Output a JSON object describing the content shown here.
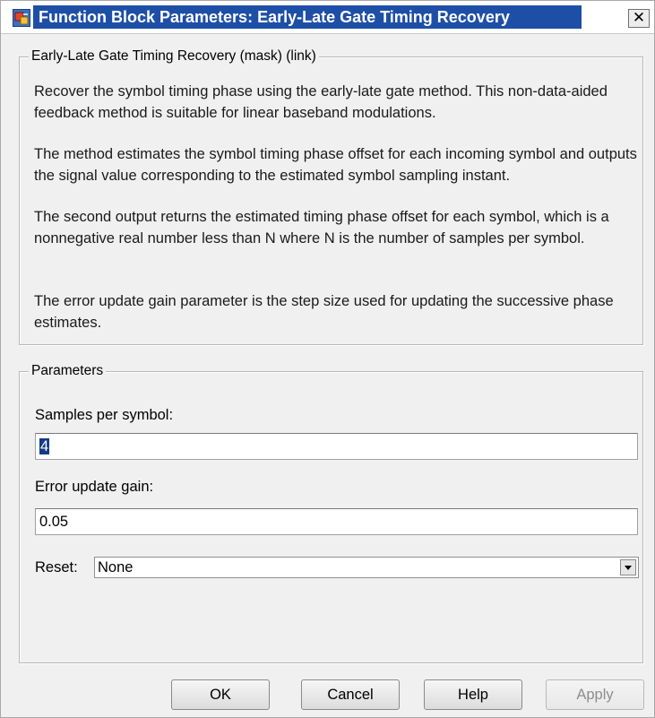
{
  "window": {
    "title": "Function Block Parameters: Early-Late Gate Timing Recovery",
    "close_glyph": "✕",
    "icon": "simulink-block-icon",
    "title_bar_color": "#1e4fa6"
  },
  "description": {
    "legend": "Early-Late Gate Timing Recovery (mask) (link)",
    "paragraphs": [
      "Recover the symbol timing phase using the early-late gate method. This non-data-aided feedback method is suitable for linear baseband modulations.",
      "The method estimates the symbol timing phase offset for each incoming symbol and outputs the signal value corresponding to the estimated symbol sampling instant.",
      "The second output returns the estimated timing phase offset for each symbol, which is a nonnegative real number less than N where N is the number of samples per symbol.",
      "The error update gain parameter is the step size used for updating the successive phase estimates."
    ]
  },
  "parameters": {
    "legend": "Parameters",
    "samples_per_symbol": {
      "label": "Samples per symbol:",
      "value": "4"
    },
    "error_update_gain": {
      "label": "Error update gain:",
      "value": "0.05"
    },
    "reset": {
      "label": "Reset:",
      "value": "None"
    }
  },
  "buttons": {
    "ok": "OK",
    "cancel": "Cancel",
    "help": "Help",
    "apply": "Apply"
  }
}
